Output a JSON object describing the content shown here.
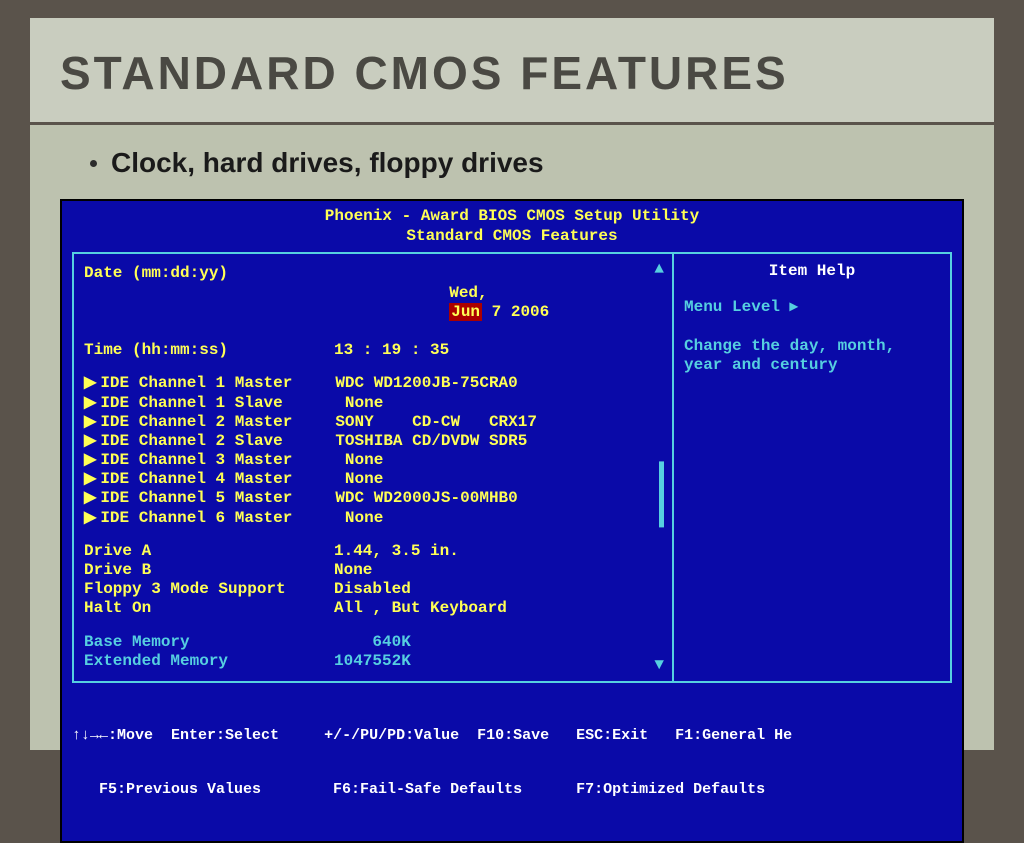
{
  "slide": {
    "title": "STANDARD CMOS FEATURES",
    "bullet": "Clock, hard drives, floppy drives"
  },
  "bios": {
    "title": "Phoenix - Award BIOS CMOS Setup Utility",
    "subtitle": "Standard CMOS Features",
    "date_label": "Date (mm:dd:yy)",
    "date_day": "Wed,",
    "date_month": "Jun",
    "date_rest": " 7 2006",
    "time_label": "Time (hh:mm:ss)",
    "time_value": "13 : 19 : 35",
    "ide": [
      {
        "label": "IDE Channel 1 Master",
        "value": "WDC WD1200JB-75CRA0"
      },
      {
        "label": "IDE Channel 1 Slave",
        "value": " None"
      },
      {
        "label": "IDE Channel 2 Master",
        "value": "SONY    CD-CW   CRX17"
      },
      {
        "label": "IDE Channel 2 Slave",
        "value": "TOSHIBA CD/DVDW SDR5"
      },
      {
        "label": "IDE Channel 3 Master",
        "value": " None"
      },
      {
        "label": "IDE Channel 4 Master",
        "value": " None"
      },
      {
        "label": "IDE Channel 5 Master",
        "value": "WDC WD2000JS-00MHB0"
      },
      {
        "label": "IDE Channel 6 Master",
        "value": " None"
      }
    ],
    "drive_a_label": "Drive A",
    "drive_a_value": "1.44, 3.5 in.",
    "drive_b_label": "Drive B",
    "drive_b_value": "None",
    "floppy3_label": "Floppy 3 Mode Support",
    "floppy3_value": "Disabled",
    "halt_label": "Halt On",
    "halt_value": "All , But Keyboard",
    "base_mem_label": "Base Memory",
    "base_mem_value": "    640K",
    "ext_mem_label": "Extended Memory",
    "ext_mem_value": "1047552K",
    "help": {
      "title": "Item Help",
      "menu_level": "Menu Level    ▸",
      "text": "Change the day, month, year and century"
    },
    "footer": {
      "line1_a": "↑↓→←:Move  Enter:Select",
      "line1_b": "+/-/PU/PD:Value  F10:Save",
      "line1_c": "ESC:Exit   F1:General He",
      "line2_a": "   F5:Previous Values",
      "line2_b": "F6:Fail-Safe Defaults",
      "line2_c": "F7:Optimized Defaults"
    }
  }
}
